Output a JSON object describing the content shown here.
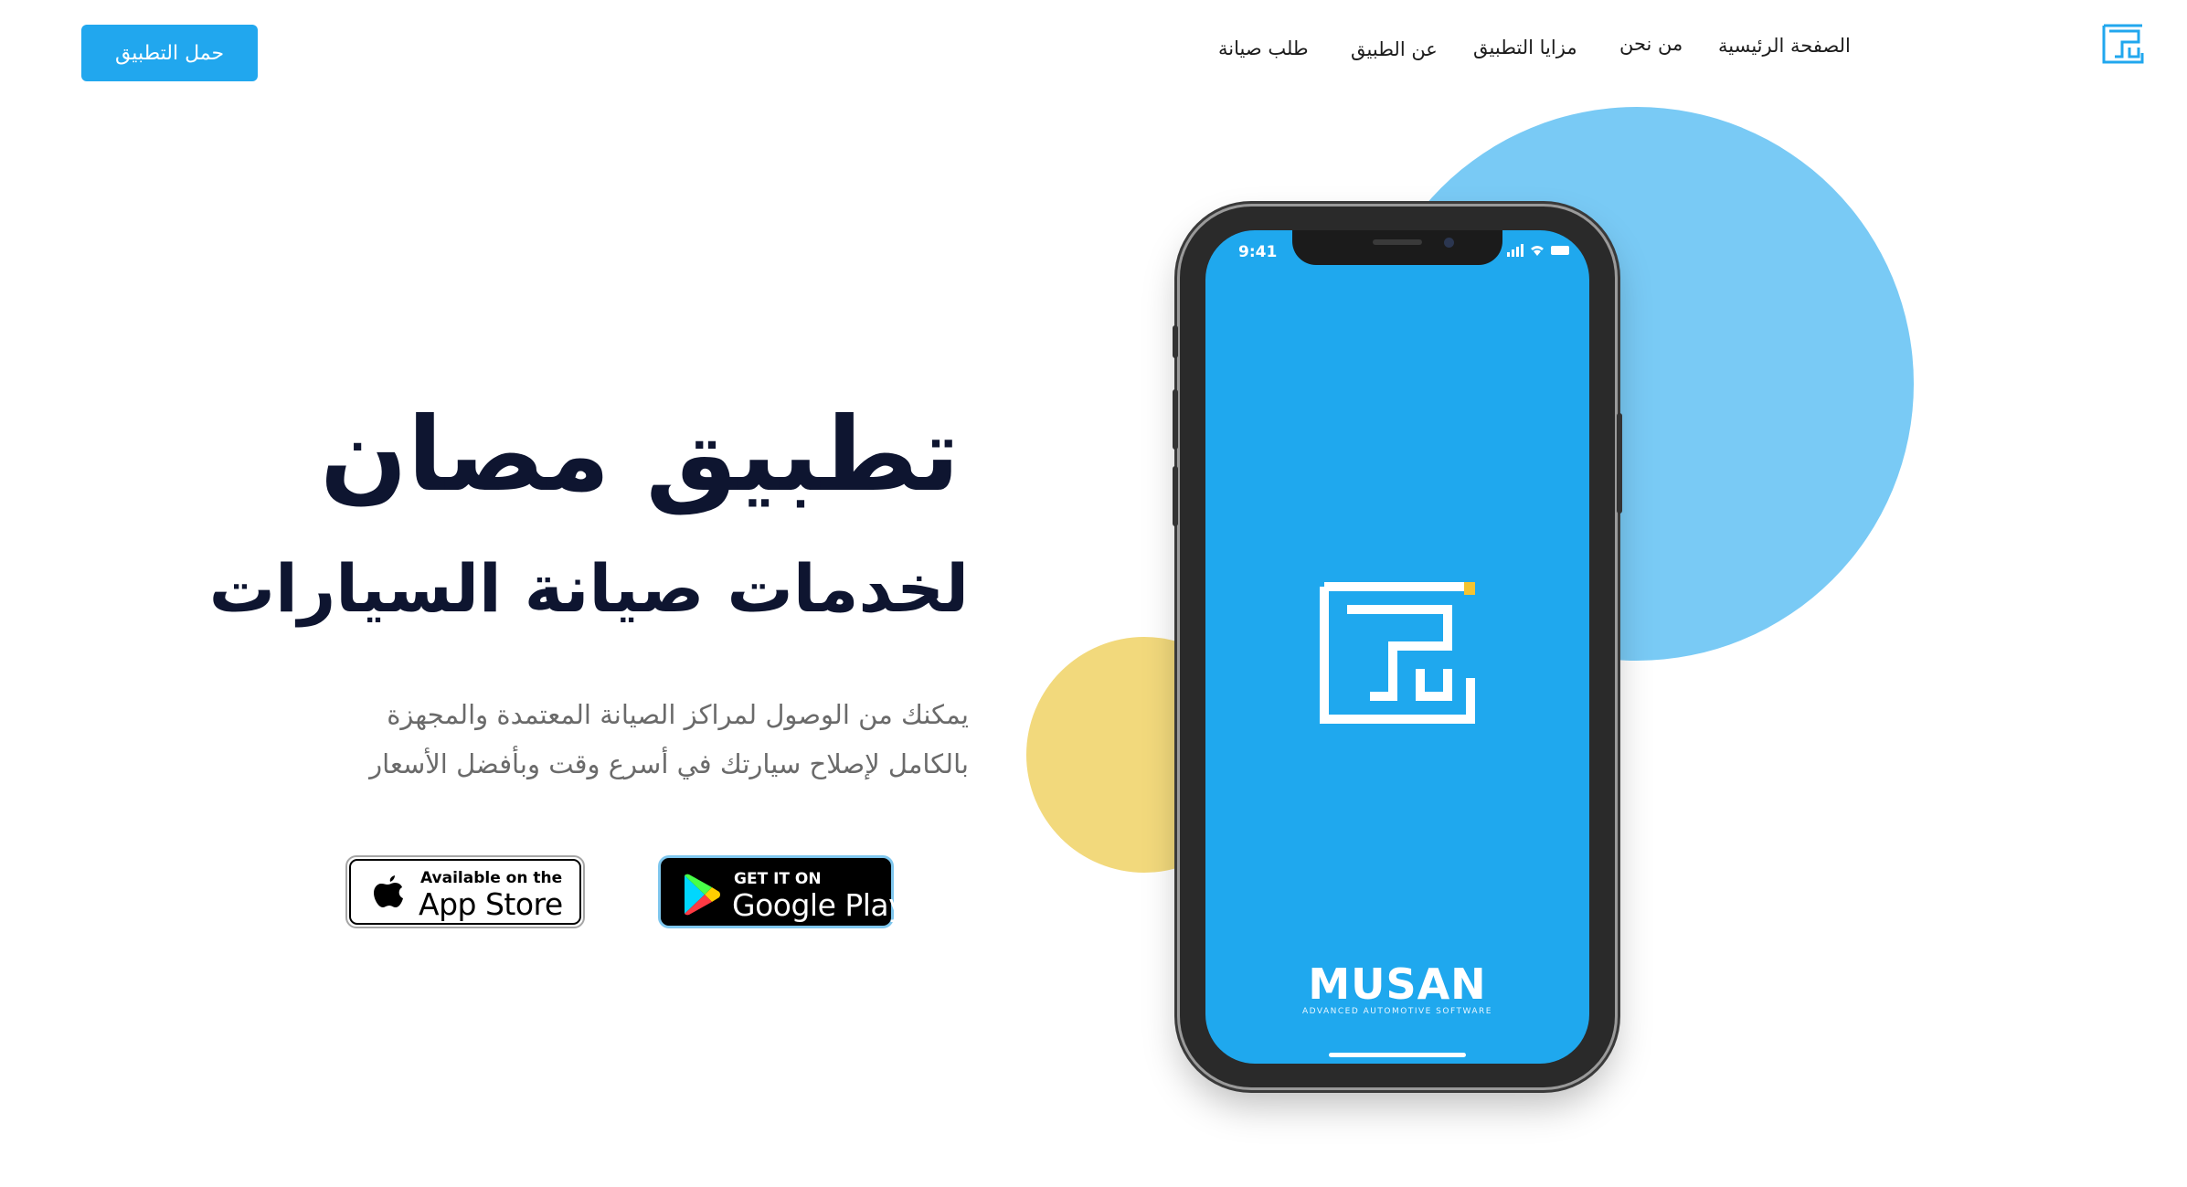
{
  "nav": {
    "items": [
      {
        "label": "الصفحة الرئيسية"
      },
      {
        "label": "من نحن"
      },
      {
        "label": "مزايا التطبيق"
      },
      {
        "label": "عن الطبيق"
      },
      {
        "label": "طلب صيانة"
      }
    ],
    "cta_label": "حمل التطبيق",
    "logo_icon": "musan-logo-icon"
  },
  "hero": {
    "title": "تطبيق مصان",
    "subtitle": "لخدمات صيانة السيارات",
    "description_line1": "يمكنك من الوصول لمراكز الصيانة المعتمدة والمجهزة",
    "description_line2": "بالكامل لإصلاح سيارتك في أسرع وقت وبأفضل الأسعار"
  },
  "badges": {
    "app_store": {
      "small": "Available on the",
      "big": "App Store",
      "icon": "apple-icon"
    },
    "google_play": {
      "small": "GET IT ON",
      "big": "Google Play",
      "icon": "google-play-icon"
    }
  },
  "phone": {
    "time": "9:41",
    "brand": "MUSAN",
    "tagline": "ADVANCED AUTOMOTIVE SOFTWARE",
    "logo_icon": "musan-logo-icon"
  },
  "colors": {
    "accent": "#21a7ee",
    "screen": "#1fa8ee",
    "circle_blue": "#79caf5",
    "circle_yellow": "#f2d97c",
    "heading": "#0e1530"
  }
}
